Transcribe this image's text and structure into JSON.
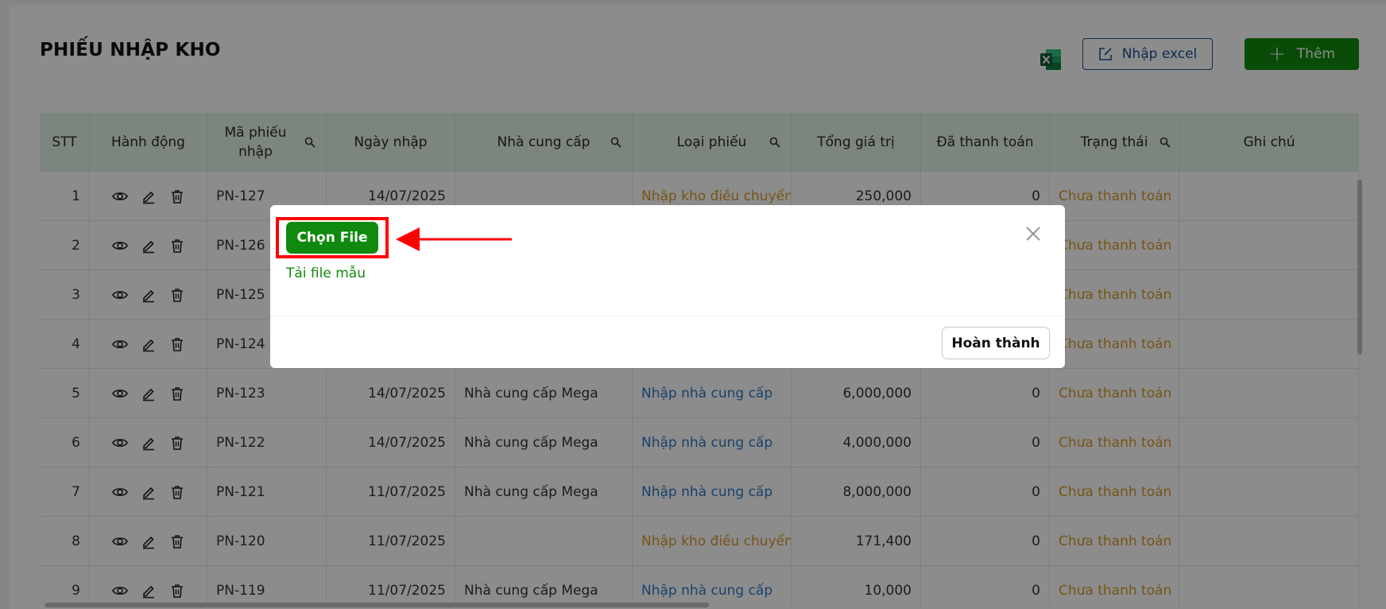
{
  "page": {
    "title": "PHIẾU NHẬP KHO"
  },
  "toolbar": {
    "import_label": "Nhập excel",
    "add_label": "Thêm"
  },
  "table": {
    "headers": {
      "stt": "STT",
      "action": "Hành động",
      "code": "Mã phiếu nhập",
      "date": "Ngày nhập",
      "supplier": "Nhà cung cấp",
      "type": "Loại phiếu",
      "total": "Tổng giá trị",
      "paid": "Đã thanh toán",
      "status": "Trạng thái",
      "note": "Ghi chú"
    },
    "rows": [
      {
        "stt": "1",
        "code": "PN-127",
        "date": "14/07/2025",
        "supplier": "",
        "type": "Nhập kho điều chuyển",
        "total": "250,000",
        "paid": "0",
        "status": "Chưa thanh toán",
        "note": ""
      },
      {
        "stt": "2",
        "code": "PN-126",
        "date": "",
        "supplier": "",
        "type": "",
        "total": "",
        "paid": "",
        "status": "Chưa thanh toán",
        "note": ""
      },
      {
        "stt": "3",
        "code": "PN-125",
        "date": "",
        "supplier": "",
        "type": "",
        "total": "",
        "paid": "",
        "status": "Chưa thanh toán",
        "note": ""
      },
      {
        "stt": "4",
        "code": "PN-124",
        "date": "",
        "supplier": "",
        "type": "",
        "total": "",
        "paid": "",
        "status": "Chưa thanh toán",
        "note": ""
      },
      {
        "stt": "5",
        "code": "PN-123",
        "date": "14/07/2025",
        "supplier": "Nhà cung cấp Mega",
        "type": "Nhập nhà cung cấp",
        "total": "6,000,000",
        "paid": "0",
        "status": "Chưa thanh toán",
        "note": ""
      },
      {
        "stt": "6",
        "code": "PN-122",
        "date": "14/07/2025",
        "supplier": "Nhà cung cấp Mega",
        "type": "Nhập nhà cung cấp",
        "total": "4,000,000",
        "paid": "0",
        "status": "Chưa thanh toán",
        "note": ""
      },
      {
        "stt": "7",
        "code": "PN-121",
        "date": "11/07/2025",
        "supplier": "Nhà cung cấp Mega",
        "type": "Nhập nhà cung cấp",
        "total": "8,000,000",
        "paid": "0",
        "status": "Chưa thanh toán",
        "note": ""
      },
      {
        "stt": "8",
        "code": "PN-120",
        "date": "11/07/2025",
        "supplier": "",
        "type": "Nhập kho điều chuyển",
        "total": "171,400",
        "paid": "0",
        "status": "Chưa thanh toán",
        "note": ""
      },
      {
        "stt": "9",
        "code": "PN-119",
        "date": "11/07/2025",
        "supplier": "Nhà cung cấp Mega",
        "type": "Nhập nhà cung cấp",
        "total": "10,000",
        "paid": "0",
        "status": "Chưa thanh toán",
        "note": ""
      }
    ]
  },
  "modal": {
    "choose_file_label": "Chọn File",
    "download_template_label": "Tải file mẫu",
    "finish_label": "Hoàn thành"
  },
  "icons": {
    "excel": "excel-icon",
    "import": "edit-square-icon",
    "add": "plus-icon",
    "search": "search-icon",
    "view": "eye-icon",
    "edit": "pencil-icon",
    "delete": "trash-icon",
    "close": "close-icon",
    "annotation": "red-arrow-icon"
  },
  "colors": {
    "primary_green": "#0f8a0f",
    "header_bg": "#e2f2e6",
    "status_orange": "#d99a2b",
    "type_blue": "#2f78c4",
    "link_blue": "#1d4f91",
    "highlight_red": "#ff0000"
  }
}
